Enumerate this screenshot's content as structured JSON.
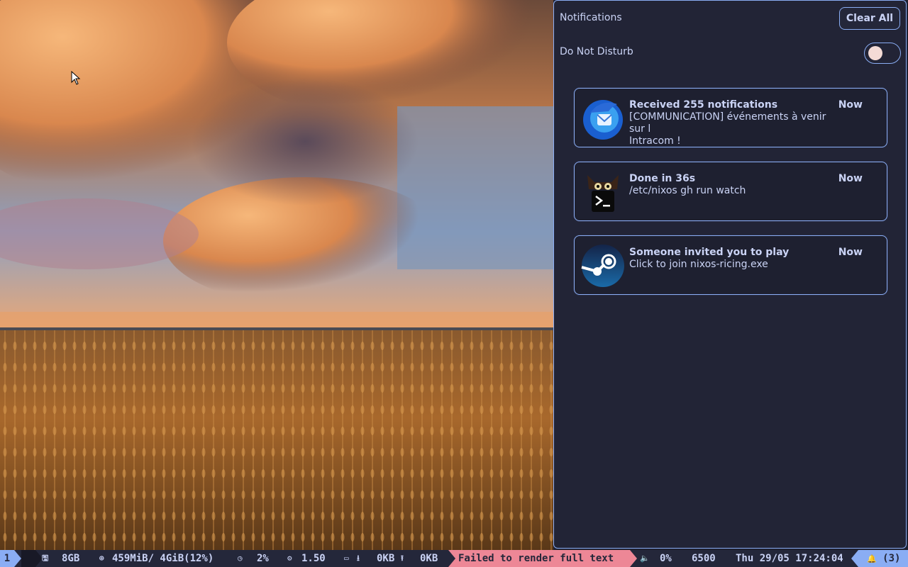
{
  "panel": {
    "title": "Notifications",
    "clear_all_label": "Clear All",
    "dnd_label": "Do Not Disturb",
    "dnd_enabled": false
  },
  "notifications": [
    {
      "icon": "thunderbird-icon",
      "summary": "Received 255 notifications",
      "time": "Now",
      "body": "[COMMUNICATION] événements à venir sur l\nIntracom !"
    },
    {
      "icon": "terminal-cat-icon",
      "summary": "Done in 36s",
      "time": "Now",
      "body": "/etc/nixos gh run watch"
    },
    {
      "icon": "steam-icon",
      "summary": "Someone invited you to play",
      "time": "Now",
      "body": "Click to join nixos-ricing.exe"
    }
  ],
  "statusbar": {
    "workspace": "1",
    "disk": "8GB",
    "memory": "459MiB/ 4GiB(12%)",
    "cpu": "2%",
    "load": "1.50",
    "net_down": "0KB",
    "net_up": "0KB",
    "error": "Failed to render full text",
    "volume": "0%",
    "brightness": "6500",
    "datetime": "Thu 29/05 17:24:04",
    "notif_count": "(3)"
  },
  "colors": {
    "accent": "#8aadf4",
    "text": "#cad3f5",
    "panel_bg": "#222436",
    "bar_bg": "#24273a",
    "error": "#ed8796",
    "knob": "#f4dbd6"
  }
}
